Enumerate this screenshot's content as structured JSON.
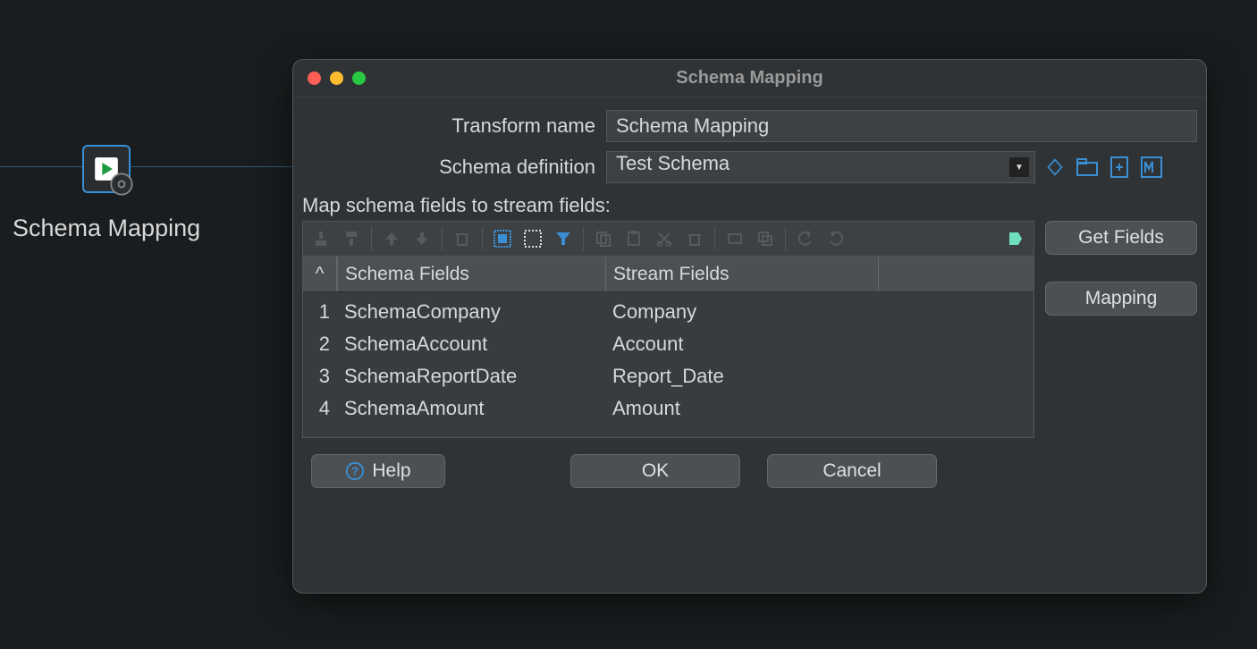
{
  "canvas": {
    "node_label": "Schema Mapping"
  },
  "dialog": {
    "title": "Schema Mapping",
    "transform_name_label": "Transform name",
    "transform_name_value": "Schema Mapping",
    "schema_def_label": "Schema definition",
    "schema_def_value": "Test Schema",
    "map_section_label": "Map schema fields to stream fields:",
    "table": {
      "header_index": "^",
      "header_schema": "Schema Fields",
      "header_stream": "Stream Fields",
      "rows": [
        {
          "idx": "1",
          "schema": "SchemaCompany",
          "stream": "Company"
        },
        {
          "idx": "2",
          "schema": "SchemaAccount",
          "stream": "Account"
        },
        {
          "idx": "3",
          "schema": "SchemaReportDate",
          "stream": "Report_Date"
        },
        {
          "idx": "4",
          "schema": "SchemaAmount",
          "stream": "Amount"
        }
      ]
    },
    "buttons": {
      "get_fields": "Get Fields",
      "mapping": "Mapping",
      "help": "Help",
      "ok": "OK",
      "cancel": "Cancel"
    }
  },
  "colors": {
    "accent_blue": "#3a8fd4"
  }
}
